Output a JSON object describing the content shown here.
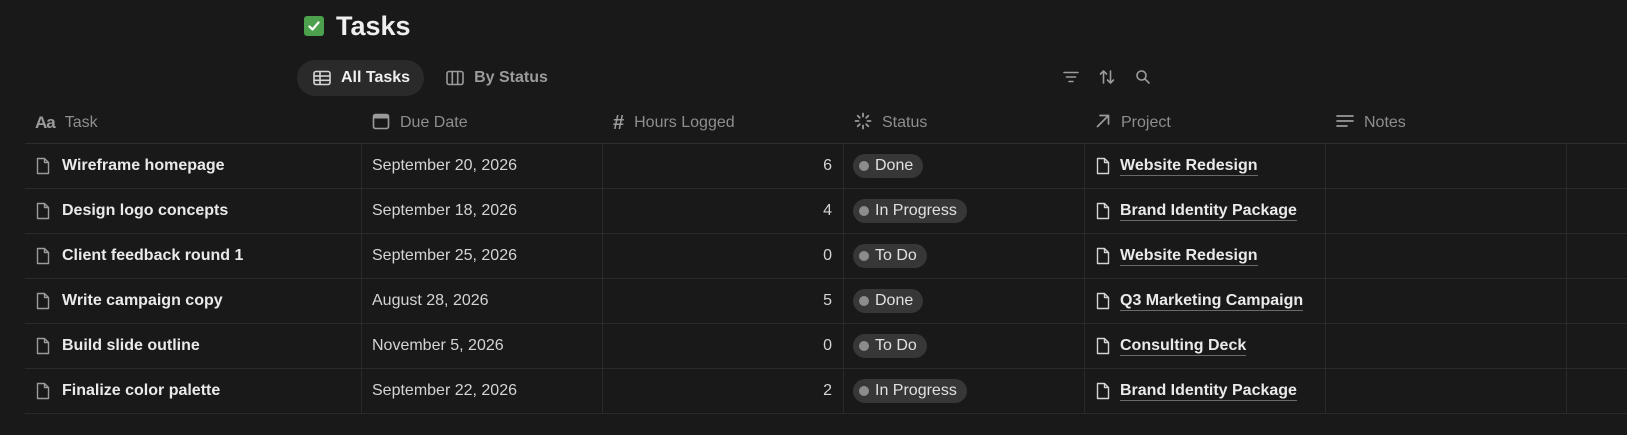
{
  "page": {
    "title": "Tasks",
    "title_icon": "check-box-icon",
    "accent": "#4da14c"
  },
  "views": [
    {
      "label": "All Tasks",
      "icon": "table-icon",
      "active": true
    },
    {
      "label": "By Status",
      "icon": "board-icon",
      "active": false
    }
  ],
  "toolbar": {
    "icons": [
      "filter-icon",
      "sort-icon",
      "search-icon"
    ]
  },
  "columns": [
    {
      "label": "Task",
      "icon": "text-type-icon"
    },
    {
      "label": "Due Date",
      "icon": "calendar-icon"
    },
    {
      "label": "Hours Logged",
      "icon": "hash-icon"
    },
    {
      "label": "Status",
      "icon": "status-icon"
    },
    {
      "label": "Project",
      "icon": "arrow-up-right-icon"
    },
    {
      "label": "Notes",
      "icon": "lines-icon"
    }
  ],
  "rows": [
    {
      "task": "Wireframe homepage",
      "due": "September 20, 2026",
      "hours": "6",
      "status": "Done",
      "project": "Website Redesign",
      "notes": ""
    },
    {
      "task": "Design logo concepts",
      "due": "September 18, 2026",
      "hours": "4",
      "status": "In Progress",
      "project": "Brand Identity Package",
      "notes": ""
    },
    {
      "task": "Client feedback round 1",
      "due": "September 25, 2026",
      "hours": "0",
      "status": "To Do",
      "project": "Website Redesign",
      "notes": ""
    },
    {
      "task": "Write campaign copy",
      "due": "August 28, 2026",
      "hours": "5",
      "status": "Done",
      "project": "Q3 Marketing Campaign",
      "notes": ""
    },
    {
      "task": "Build slide outline",
      "due": "November 5, 2026",
      "hours": "0",
      "status": "To Do",
      "project": "Consulting Deck",
      "notes": ""
    },
    {
      "task": "Finalize color palette",
      "due": "September 22, 2026",
      "hours": "2",
      "status": "In Progress",
      "project": "Brand Identity Package",
      "notes": ""
    }
  ]
}
